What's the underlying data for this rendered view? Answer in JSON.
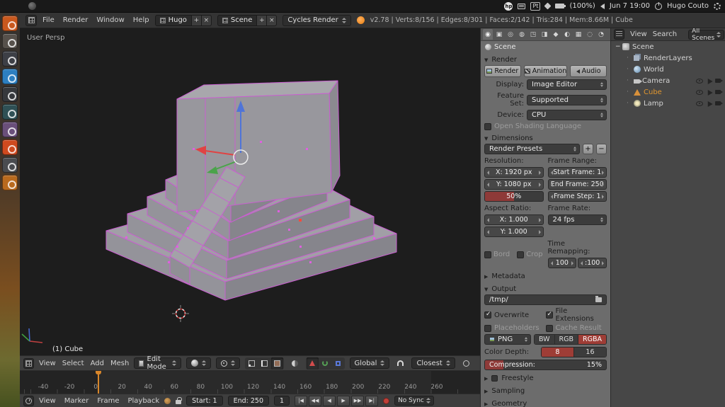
{
  "ubuntu_panel": {
    "hp_logo": "hp",
    "keyboard_layout": "Pt",
    "battery": "(100%)",
    "datetime": "Jun 7  19:00",
    "user": "Hugo Couto"
  },
  "info_header": {
    "menus": [
      "File",
      "Render",
      "Window",
      "Help"
    ],
    "screen_name": "Hugo",
    "scene_name": "Scene",
    "add_glyph": "+",
    "close_glyph": "×",
    "engine": "Cycles Render",
    "stats": "v2.78 | Verts:8/156 | Edges:8/301 | Faces:2/142 | Tris:284 | Mem:8.66M | Cube"
  },
  "launcher": {
    "icons": [
      {
        "name": "dash-home-icon",
        "color": "#c8581e"
      },
      {
        "name": "files-icon",
        "color": "#57514b"
      },
      {
        "name": "workspace-switcher-icon",
        "color": "#3d3f46"
      },
      {
        "name": "photos-app-icon",
        "color": "#2d7fc1"
      },
      {
        "name": "screenshot-tool-icon",
        "color": "#36383c"
      },
      {
        "name": "media-app-icon",
        "color": "#2f5055"
      },
      {
        "name": "text-editor-icon",
        "color": "#6a4f7a"
      },
      {
        "name": "software-center-icon",
        "color": "#cf4a1f"
      },
      {
        "name": "system-settings-icon",
        "color": "#4a4c50"
      },
      {
        "name": "gimp-icon",
        "color": "#b96a1e"
      }
    ]
  },
  "viewport": {
    "view_label": "User Persp",
    "object_label": "(1) Cube"
  },
  "viewport_header": {
    "menus": [
      "View",
      "Select",
      "Add",
      "Mesh"
    ],
    "mode": "Edit Mode",
    "orientation": "Global",
    "snap_target": "Closest"
  },
  "timeline": {
    "menus": [
      "View",
      "Marker",
      "Frame",
      "Playback"
    ],
    "ticks": [
      "-40",
      "-20",
      "0",
      "20",
      "40",
      "60",
      "80",
      "100",
      "120",
      "140",
      "160",
      "180",
      "200",
      "220",
      "240",
      "260"
    ],
    "start": "Start: 1",
    "end": "End: 250",
    "current_frame": "1",
    "playback": [
      {
        "name": "jump-to-start-button",
        "glyph": "|◀"
      },
      {
        "name": "prev-keyframe-button",
        "glyph": "◀◀"
      },
      {
        "name": "play-reverse-button",
        "glyph": "◀"
      },
      {
        "name": "play-button",
        "glyph": "▶"
      },
      {
        "name": "next-keyframe-button",
        "glyph": "▶▶"
      },
      {
        "name": "jump-to-end-button",
        "glyph": "▶|"
      }
    ],
    "sync": "No Sync"
  },
  "properties": {
    "tabs": [
      {
        "name": "render-tab",
        "glyph": "◉",
        "active": true
      },
      {
        "name": "render-layers-tab",
        "glyph": "▣"
      },
      {
        "name": "scene-tab",
        "glyph": "◎"
      },
      {
        "name": "world-tab",
        "glyph": "◍"
      },
      {
        "name": "object-tab",
        "glyph": "◳"
      },
      {
        "name": "modifiers-tab",
        "glyph": "◨"
      },
      {
        "name": "data-tab",
        "glyph": "◆"
      },
      {
        "name": "material-tab",
        "glyph": "◐"
      },
      {
        "name": "texture-tab",
        "glyph": "▦"
      },
      {
        "name": "particles-tab",
        "glyph": "◌"
      },
      {
        "name": "physics-tab",
        "glyph": "◔"
      }
    ],
    "breadcrumb": "Scene",
    "render": {
      "title": "Render",
      "render_button": "Render",
      "animation_button": "Animation",
      "audio_button": "Audio",
      "display_label": "Display:",
      "display_value": "Image Editor",
      "feature_label": "Feature Set:",
      "feature_value": "Supported",
      "device_label": "Device:",
      "device_value": "CPU",
      "osl_label": "Open Shading Language"
    },
    "dimensions": {
      "title": "Dimensions",
      "presets": "Render Presets",
      "add_glyph": "+",
      "remove_glyph": "−",
      "resolution_label": "Resolution:",
      "res_x": "X: 1920 px",
      "res_y": "Y: 1080 px",
      "res_percent": "50%",
      "frame_range_label": "Frame Range:",
      "start_frame": "Start Frame: 1",
      "end_frame": "End Frame: 250",
      "frame_step": "Frame Step: 1",
      "aspect_label": "Aspect Ratio:",
      "aspect_x": "X: 1.000",
      "aspect_y": "Y: 1.000",
      "frame_rate_label": "Frame Rate:",
      "frame_rate": "24 fps",
      "border_label": "Bord",
      "crop_label": "Crop",
      "remap_label": "Time Remapping:",
      "remap_old": "100",
      "remap_new": ":100"
    },
    "metadata_title": "Metadata",
    "output": {
      "title": "Output",
      "path": "/tmp/",
      "overwrite": "Overwrite",
      "file_ext": "File Extensions",
      "placeholders": "Placeholders",
      "cache": "Cache Result",
      "format": "PNG",
      "bw": "BW",
      "rgb": "RGB",
      "rgba": "RGBA",
      "depth_label": "Color Depth:",
      "depth_8": "8",
      "depth_16": "16",
      "compression_label": "Compression:",
      "compression_value": "15%"
    },
    "freestyle_title": "Freestyle",
    "sampling_title": "Sampling",
    "geometry_title": "Geometry"
  },
  "outliner": {
    "menus": [
      "View",
      "Search"
    ],
    "filter": "All Scenes",
    "items": [
      {
        "label": "Scene",
        "icon": "scene",
        "expanded": true,
        "toggles": false
      },
      {
        "label": "RenderLayers",
        "icon": "renderlayers",
        "indent": 1,
        "toggles": false
      },
      {
        "label": "World",
        "icon": "world",
        "indent": 1,
        "toggles": false
      },
      {
        "label": "Camera",
        "icon": "camera",
        "indent": 1,
        "toggles": true
      },
      {
        "label": "Cube",
        "icon": "mesh",
        "indent": 1,
        "toggles": true,
        "selected": true
      },
      {
        "label": "Lamp",
        "icon": "lamp",
        "indent": 1,
        "toggles": true
      }
    ]
  },
  "colors": {
    "accent_active": "#9e3d36",
    "selected_object_text": "#e0962f",
    "edit_edge_highlight": "#c95fd0",
    "current_frame_marker": "#d8862a"
  }
}
